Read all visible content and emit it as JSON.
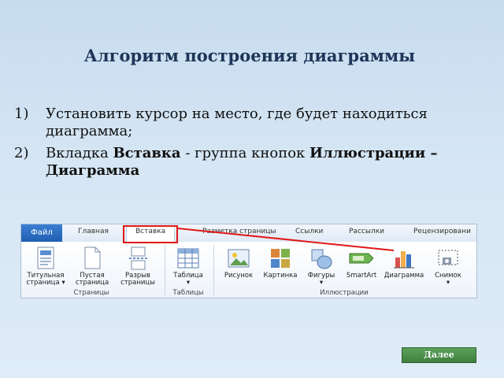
{
  "slide": {
    "title": "Алгоритм построения диаграммы",
    "items": [
      {
        "num": "1)",
        "text": "Установить курсор на место, где будет находиться диаграмма;"
      },
      {
        "num": "2)",
        "prefix": "Вкладка ",
        "bold1": "Вставка",
        "middle": " -  группа кнопок ",
        "bold2": "Иллюстрации – Диаграмма"
      }
    ],
    "next_label": "Далее"
  },
  "ribbon": {
    "tabs": [
      "Файл",
      "Главная",
      "Вставка",
      "Разметка страницы",
      "Ссылки",
      "Рассылки",
      "Рецензировани"
    ],
    "active_tab": "Вставка",
    "buttons": [
      {
        "label1": "Титульная",
        "label2": "страница ▾",
        "icon": "title-page-icon"
      },
      {
        "label1": "Пустая",
        "label2": "страница",
        "icon": "blank-page-icon"
      },
      {
        "label1": "Разрыв",
        "label2": "страницы",
        "icon": "page-break-icon"
      },
      {
        "label1": "Таблица",
        "label2": "▾",
        "icon": "table-icon"
      },
      {
        "label1": "Рисунок",
        "label2": "",
        "icon": "picture-icon"
      },
      {
        "label1": "Картинка",
        "label2": "",
        "icon": "clipart-icon"
      },
      {
        "label1": "Фигуры",
        "label2": "▾",
        "icon": "shapes-icon"
      },
      {
        "label1": "SmartArt",
        "label2": "",
        "icon": "smartart-icon"
      },
      {
        "label1": "Диаграмма",
        "label2": "",
        "icon": "chart-icon"
      },
      {
        "label1": "Снимок",
        "label2": "▾",
        "icon": "screenshot-icon"
      }
    ],
    "groups": [
      "Страницы",
      "Таблицы",
      "Иллюстрации"
    ]
  },
  "colors": {
    "highlight": "#e01818",
    "next_button": "#4f8f4d"
  }
}
